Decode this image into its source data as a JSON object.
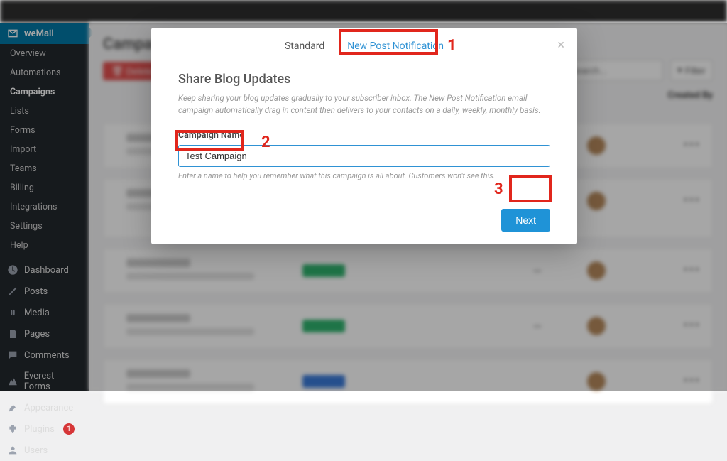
{
  "sidebar": {
    "wemail": "weMail",
    "subs": [
      "Overview",
      "Automations",
      "Campaigns",
      "Lists",
      "Forms",
      "Import",
      "Teams",
      "Billing",
      "Integrations",
      "Settings",
      "Help"
    ],
    "items": [
      {
        "label": "Dashboard"
      },
      {
        "label": "Posts"
      },
      {
        "label": "Media"
      },
      {
        "label": "Pages"
      },
      {
        "label": "Comments"
      },
      {
        "label": "Everest Forms"
      },
      {
        "label": "Appearance"
      },
      {
        "label": "Plugins",
        "badge": "1"
      },
      {
        "label": "Users"
      }
    ]
  },
  "main": {
    "heading": "Campaign",
    "delete": "Delete",
    "search_ph": "Search...",
    "filter": "Filter",
    "created_by": "Created By"
  },
  "modal": {
    "tab_standard": "Standard",
    "tab_newpost": "New Post Notification",
    "title": "Share Blog Updates",
    "desc": "Keep sharing your blog updates gradually to your subscriber inbox. The New Post Notification email campaign automatically drag in content then delivers to your contacts on a daily, weekly, monthly basis.",
    "field_label": "Campaign Name",
    "field_value": "Test Campaign",
    "field_help": "Enter a name to help you remember what this campaign is all about. Customers won't see this.",
    "next": "Next"
  },
  "ann": {
    "one": "1",
    "two": "2",
    "three": "3"
  }
}
